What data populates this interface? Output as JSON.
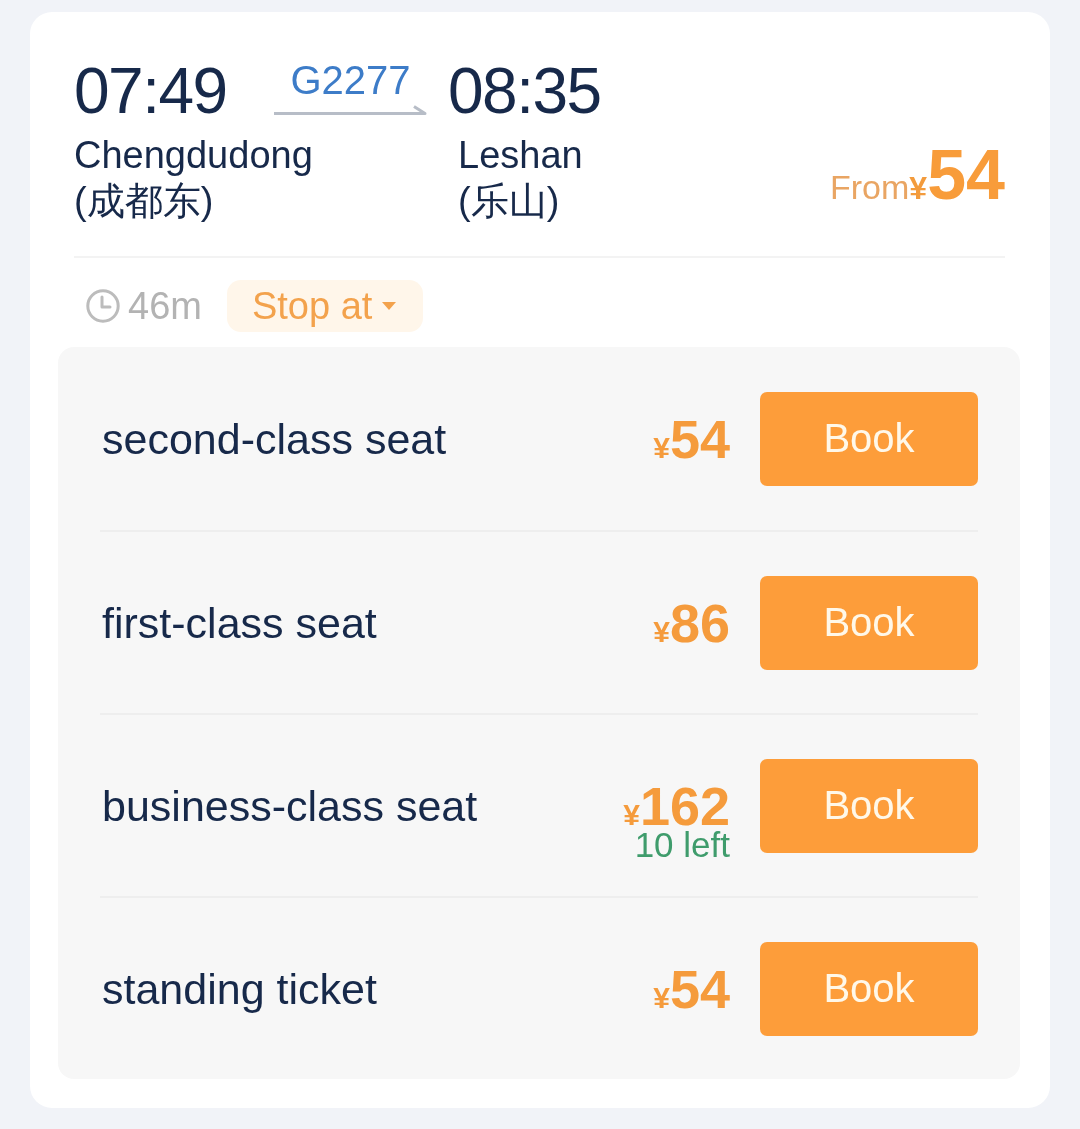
{
  "journey": {
    "departure": {
      "time": "07:49",
      "station": "Chengdudong",
      "station_local": "(成都东)"
    },
    "train_number": "G2277",
    "arrival": {
      "time": "08:35",
      "station": "Leshan",
      "station_local": "(乐山)"
    },
    "lowest_price": {
      "label": "From",
      "currency": "¥",
      "amount": "54"
    }
  },
  "details": {
    "duration": "46m",
    "stops_button": "Stop at"
  },
  "seats": [
    {
      "name": "second-class seat",
      "currency": "¥",
      "price": "54",
      "button": "Book"
    },
    {
      "name": "first-class seat",
      "currency": "¥",
      "price": "86",
      "button": "Book"
    },
    {
      "name": "business-class seat",
      "currency": "¥",
      "price": "162",
      "remaining": "10 left",
      "button": "Book"
    },
    {
      "name": "standing ticket",
      "currency": "¥",
      "price": "54",
      "button": "Book"
    }
  ]
}
